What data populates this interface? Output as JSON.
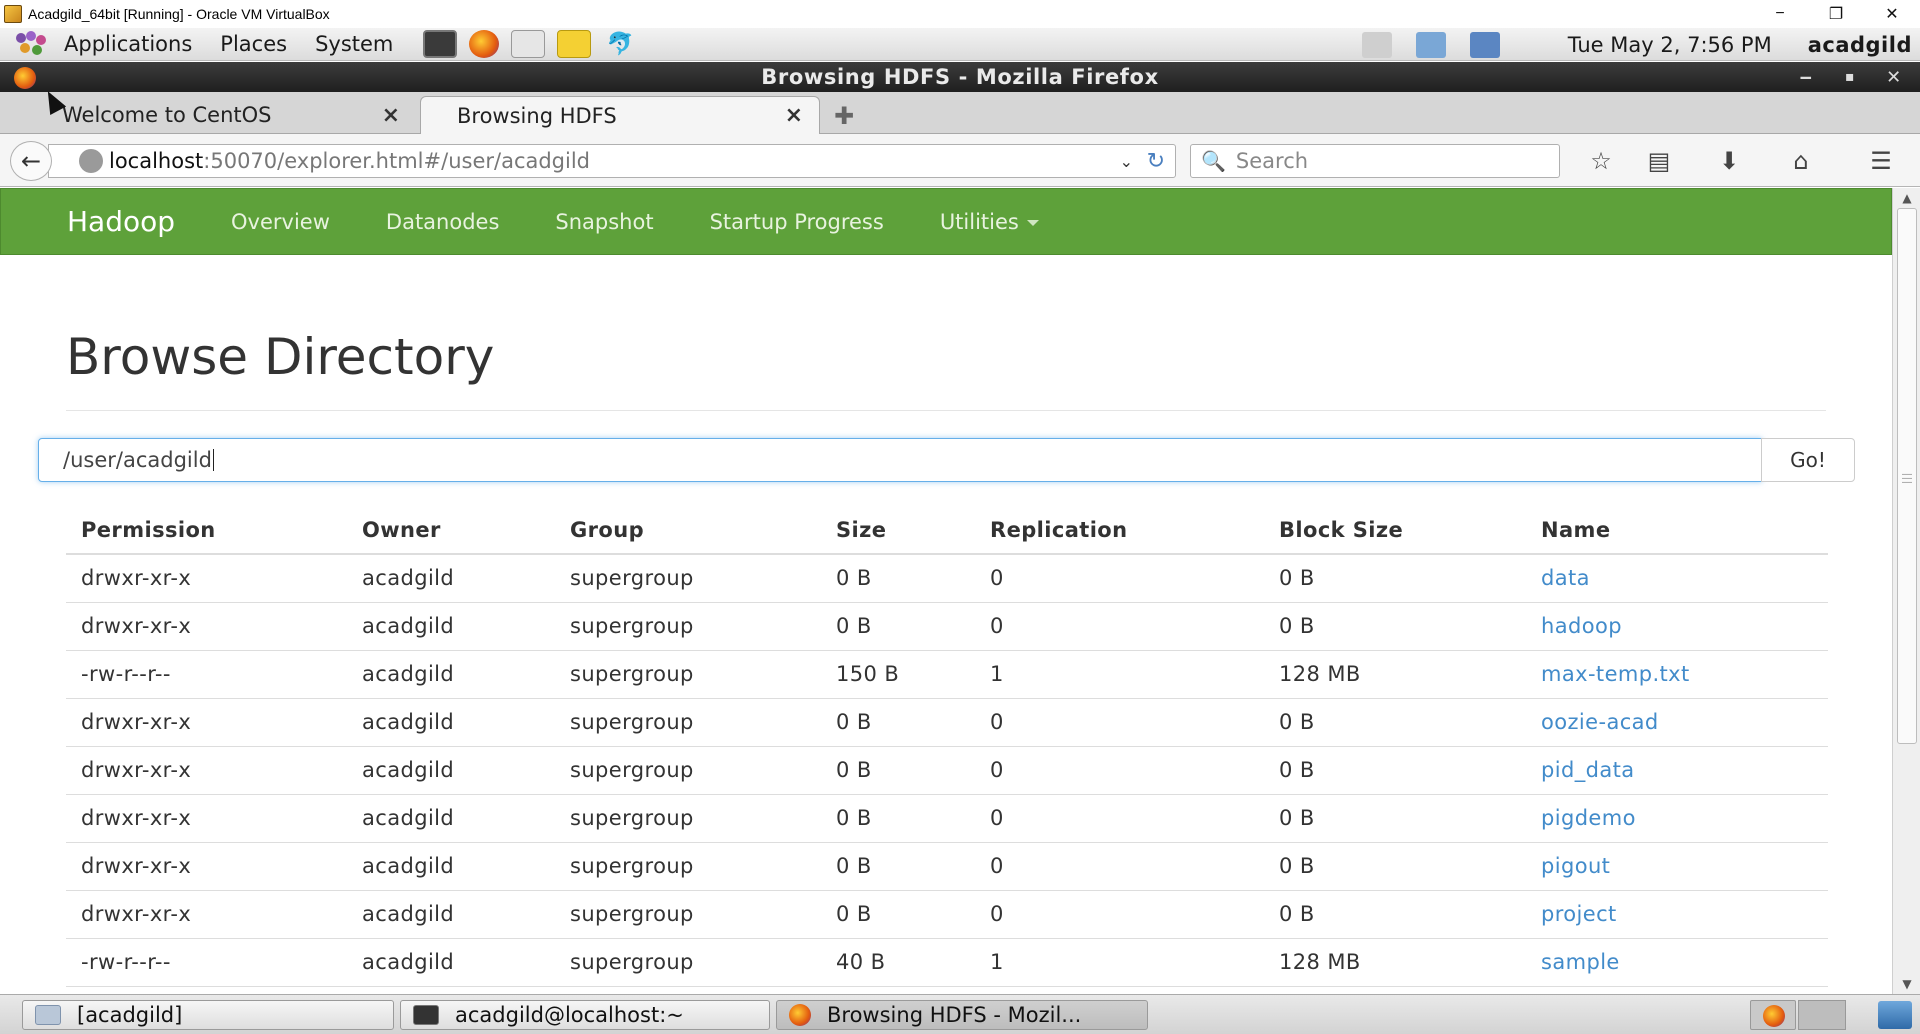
{
  "vbox": {
    "title": "Acadgild_64bit [Running] - Oracle VM VirtualBox",
    "minimize": "−",
    "restore": "❐",
    "close": "✕"
  },
  "gnome_panel": {
    "applications": "Applications",
    "places": "Places",
    "system": "System",
    "clock": "Tue May  2,  7:56 PM",
    "user": "acadgild"
  },
  "firefox": {
    "window_title": "Browsing HDFS - Mozilla Firefox",
    "tabs": [
      {
        "label": "Welcome to CentOS",
        "close": "×"
      },
      {
        "label": "Browsing HDFS",
        "close": "×"
      }
    ],
    "new_tab": "✚",
    "url_host": "localhost",
    "url_path": ":50070/explorer.html#/user/acadgild",
    "search_placeholder": "Search"
  },
  "hadoop": {
    "brand": "Hadoop",
    "nav": [
      "Overview",
      "Datanodes",
      "Snapshot",
      "Startup Progress",
      "Utilities"
    ],
    "page_title": "Browse Directory",
    "directory_value": "/user/acadgild",
    "go_label": "Go!",
    "link_color": "#428bca",
    "navbar_color": "#5ea13a",
    "table": {
      "headers": [
        "Permission",
        "Owner",
        "Group",
        "Size",
        "Replication",
        "Block Size",
        "Name"
      ],
      "rows": [
        {
          "permission": "drwxr-xr-x",
          "owner": "acadgild",
          "group": "supergroup",
          "size": "0 B",
          "replication": "0",
          "block_size": "0 B",
          "name": "data"
        },
        {
          "permission": "drwxr-xr-x",
          "owner": "acadgild",
          "group": "supergroup",
          "size": "0 B",
          "replication": "0",
          "block_size": "0 B",
          "name": "hadoop"
        },
        {
          "permission": "-rw-r--r--",
          "owner": "acadgild",
          "group": "supergroup",
          "size": "150 B",
          "replication": "1",
          "block_size": "128 MB",
          "name": "max-temp.txt"
        },
        {
          "permission": "drwxr-xr-x",
          "owner": "acadgild",
          "group": "supergroup",
          "size": "0 B",
          "replication": "0",
          "block_size": "0 B",
          "name": "oozie-acad"
        },
        {
          "permission": "drwxr-xr-x",
          "owner": "acadgild",
          "group": "supergroup",
          "size": "0 B",
          "replication": "0",
          "block_size": "0 B",
          "name": "pid_data"
        },
        {
          "permission": "drwxr-xr-x",
          "owner": "acadgild",
          "group": "supergroup",
          "size": "0 B",
          "replication": "0",
          "block_size": "0 B",
          "name": "pigdemo"
        },
        {
          "permission": "drwxr-xr-x",
          "owner": "acadgild",
          "group": "supergroup",
          "size": "0 B",
          "replication": "0",
          "block_size": "0 B",
          "name": "pigout"
        },
        {
          "permission": "drwxr-xr-x",
          "owner": "acadgild",
          "group": "supergroup",
          "size": "0 B",
          "replication": "0",
          "block_size": "0 B",
          "name": "project"
        },
        {
          "permission": "-rw-r--r--",
          "owner": "acadgild",
          "group": "supergroup",
          "size": "40 B",
          "replication": "1",
          "block_size": "128 MB",
          "name": "sample"
        }
      ]
    }
  },
  "taskbar": {
    "items": [
      "[acadgild]",
      "acadgild@localhost:~",
      "Browsing HDFS - Mozil..."
    ]
  }
}
